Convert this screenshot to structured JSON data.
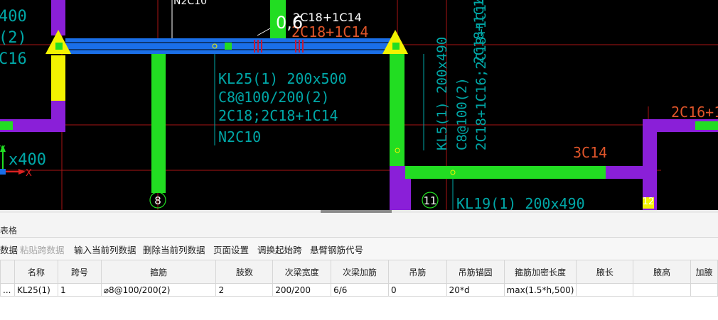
{
  "drawing": {
    "left_labels": [
      "400",
      "(2)",
      "C16"
    ],
    "left_dim": "x400",
    "top_cut_label": "N2C10",
    "span_label": "0,6",
    "top_rebar_label": "2C18+1C14",
    "top_rebar_label_ghost": "2C18+1C14",
    "kl25": [
      "KL25(1) 200x500",
      "C8@100/200(2)",
      "2C18;2C18+1C14",
      "N2C10"
    ],
    "kl5": [
      "KL5(1) 200x490",
      "C8@100(2)",
      "2C18+1C16;2C18+1C14"
    ],
    "right_label": "2C16+1",
    "right_vertical": "2C18+1C14",
    "lower_label": "3C14",
    "axis_8": "8",
    "axis_11": "11",
    "axis_12": "12",
    "bottom_beam": "KL19(1) 200x490",
    "axis_x": "X",
    "axis_y": "Y",
    "colors": {
      "beam_green": "#22dd22",
      "column_purple": "#8a1fd8",
      "highlight_blue": "#1a6fe8",
      "arrow_yellow": "#f3f300",
      "text_cyan": "#00a7a7",
      "axis_red": "#cc2020"
    }
  },
  "panel": {
    "title": "表格"
  },
  "toolbar": {
    "items": [
      {
        "label": "数据",
        "enabled": true
      },
      {
        "label": "粘贴跨数据",
        "enabled": false
      },
      {
        "label": "输入当前列数据",
        "enabled": true
      },
      {
        "label": "删除当前列数据",
        "enabled": true
      },
      {
        "label": "页面设置",
        "enabled": true
      },
      {
        "label": "调换起始跨",
        "enabled": true
      },
      {
        "label": "悬臂钢筋代号",
        "enabled": true
      }
    ]
  },
  "grid": {
    "headers": [
      "",
      "名称",
      "跨号",
      "箍筋",
      "肢数",
      "次梁宽度",
      "次梁加筋",
      "吊筋",
      "吊筋锚固",
      "箍筋加密长度",
      "腋长",
      "腋高",
      "加腋"
    ],
    "row": [
      "...",
      "KL25(1)",
      "1",
      "⌀8@100/200(2)",
      "2",
      "200/200",
      "6/6",
      "0",
      "20*d",
      "max(1.5*h,500)",
      "",
      "",
      ""
    ]
  }
}
